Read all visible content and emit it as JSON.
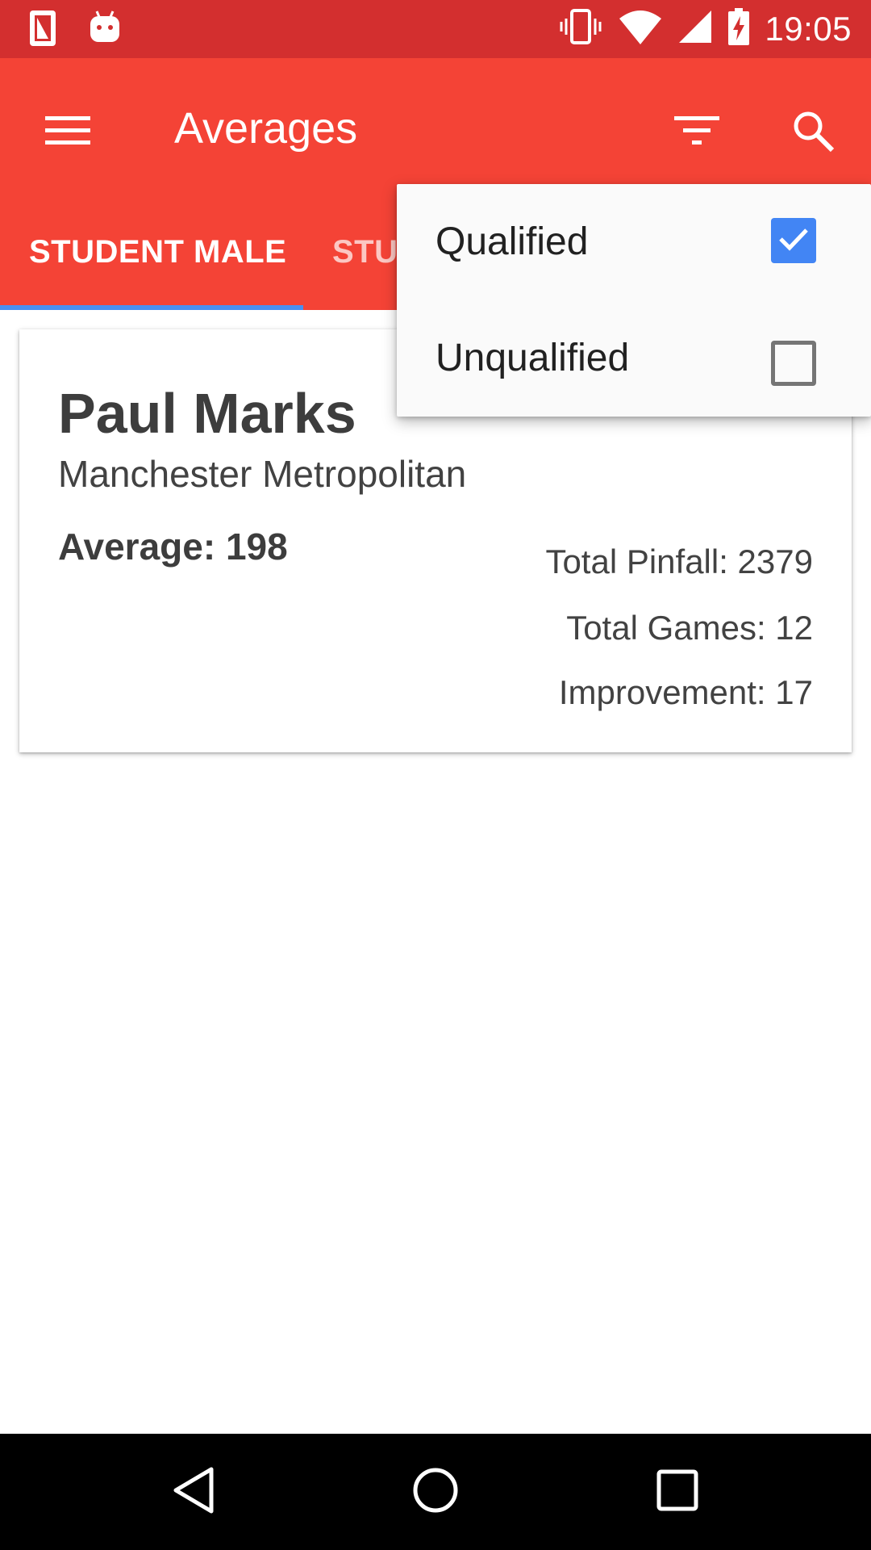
{
  "status_bar": {
    "time": "19:05",
    "icons": [
      "sim-card-icon",
      "android-icon",
      "vibrate-icon",
      "wifi-icon",
      "signal-icon",
      "battery-charging-icon"
    ]
  },
  "app_bar": {
    "title": "Averages",
    "icons": [
      "menu-icon",
      "filter-icon",
      "search-icon"
    ]
  },
  "tabs": [
    {
      "label": "STUDENT MALE",
      "selected": true
    },
    {
      "label": "STU",
      "selected": false
    }
  ],
  "card": {
    "name": "Paul Marks",
    "university": "Manchester Metropolitan",
    "average": "Average: 198",
    "stats": [
      {
        "text": "Total Pinfall: 2379"
      },
      {
        "text": "Total Games: 12"
      },
      {
        "text": "Improvement: 17"
      }
    ]
  },
  "filter_menu": {
    "items": [
      {
        "label": "Qualified",
        "checked": true
      },
      {
        "label": "Unqualified",
        "checked": false
      }
    ]
  },
  "nav_bar": {
    "icons": [
      "back-icon",
      "home-icon",
      "recents-icon"
    ]
  },
  "colors": {
    "status_bar": "#d32f2f",
    "app_bar": "#f44336",
    "tab_indicator": "#4a8ff0",
    "checkbox_checked": "#4285f4",
    "text_primary": "#3d3d3d"
  }
}
